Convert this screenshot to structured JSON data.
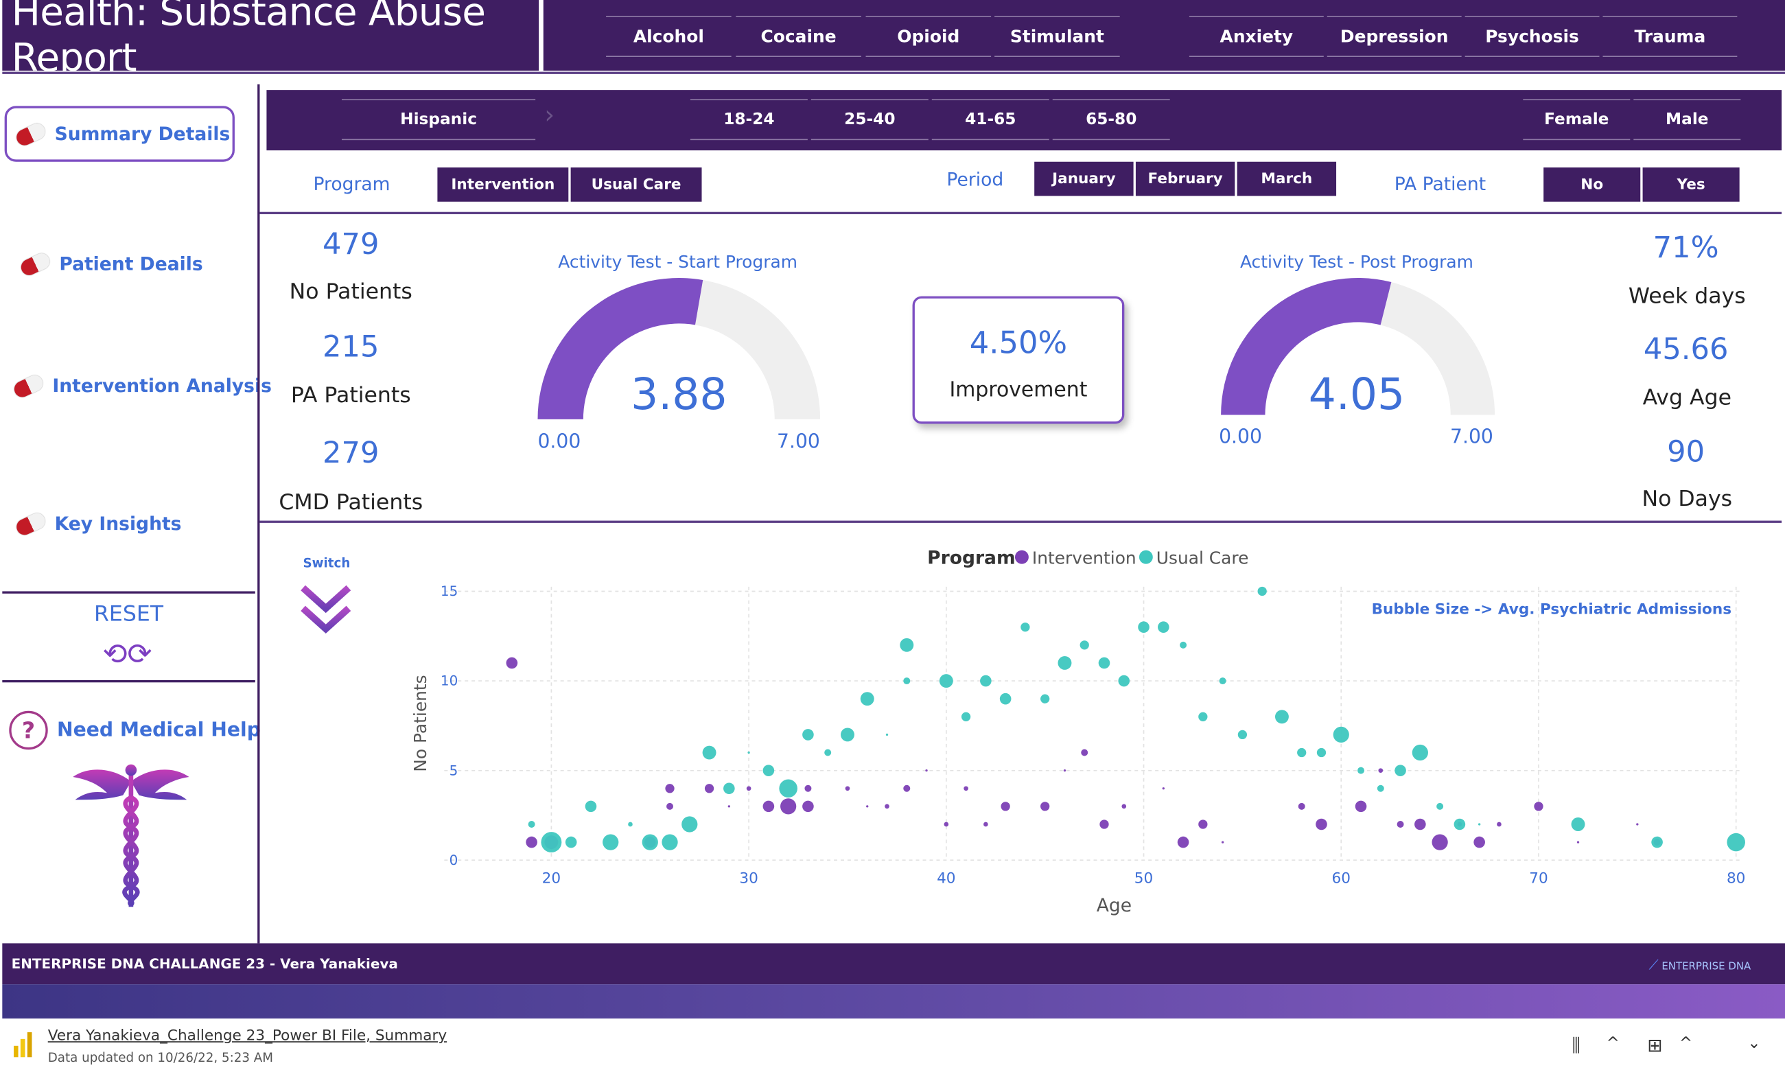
{
  "title": "Health: Substance Abuse Report",
  "substances": [
    "Alcohol",
    "Cocaine",
    "Opioid",
    "Stimulant"
  ],
  "conditions": [
    "Anxiety",
    "Depression",
    "Psychosis",
    "Trauma"
  ],
  "sidebar": {
    "items": [
      "Summary Details",
      "Patient Deails",
      "Intervention Analysis",
      "Key Insights"
    ],
    "reset": "RESET",
    "help": "Need Medical Help"
  },
  "filters": {
    "ethnicity": "Hispanic",
    "ages": [
      "18-24",
      "25-40",
      "41-65",
      "65-80"
    ],
    "genders": [
      "Female",
      "Male"
    ],
    "program_label": "Program",
    "program_options": [
      "Intervention",
      "Usual Care"
    ],
    "period_label": "Period",
    "period_options": [
      "January",
      "February",
      "March"
    ],
    "pa_label": "PA Patient",
    "pa_options": [
      "No",
      "Yes"
    ]
  },
  "kpis": {
    "no_patients": "479",
    "no_patients_label": "No Patients",
    "pa_patients": "215",
    "pa_patients_label": "PA Patients",
    "cmd_patients": "279",
    "cmd_patients_label": "CMD Patients",
    "week_days": "71%",
    "week_days_label": "Week days",
    "avg_age": "45.66",
    "avg_age_label": "Avg Age",
    "no_days": "90",
    "no_days_label": "No Days",
    "improvement": "4.50%",
    "improvement_label": "Improvement"
  },
  "gauges": [
    {
      "title": "Activity Test - Start Program",
      "value": 3.88,
      "value_text": "3.88",
      "min": "0.00",
      "max": "7.00"
    },
    {
      "title": "Activity Test - Post Program",
      "value": 4.05,
      "value_text": "4.05",
      "min": "0.00",
      "max": "7.00"
    }
  ],
  "switch_label": "Switch",
  "chart_data": {
    "type": "scatter",
    "legend_title": "Program",
    "legend": [
      "Intervention",
      "Usual Care"
    ],
    "legend_placement": "top",
    "annotation": "Bubble Size -> Avg. Psychiatric Admissions",
    "xlabel": "Age",
    "ylabel": "No Patients",
    "xlim": [
      18,
      80
    ],
    "ylim": [
      0,
      15
    ],
    "xticks": [
      "20",
      "30",
      "40",
      "50",
      "60",
      "70",
      "80"
    ],
    "yticks": [
      "0",
      "5",
      "10",
      "15"
    ],
    "grid": true,
    "colors": {
      "Intervention": "#7c3fb5",
      "Usual Care": "#3ec7bf"
    },
    "series": [
      {
        "name": "Intervention",
        "points": [
          [
            18,
            11,
            5
          ],
          [
            19,
            1,
            5
          ],
          [
            20,
            1,
            6
          ],
          [
            25,
            1,
            5
          ],
          [
            26,
            3,
            3
          ],
          [
            26,
            4,
            4
          ],
          [
            28,
            4,
            4
          ],
          [
            29,
            3,
            1
          ],
          [
            30,
            4,
            2
          ],
          [
            31,
            3,
            5
          ],
          [
            32,
            3,
            7
          ],
          [
            33,
            3,
            5
          ],
          [
            33,
            4,
            3
          ],
          [
            35,
            4,
            2
          ],
          [
            36,
            3,
            1
          ],
          [
            37,
            3,
            2
          ],
          [
            38,
            4,
            3
          ],
          [
            39,
            5,
            1
          ],
          [
            40,
            2,
            2
          ],
          [
            41,
            4,
            2
          ],
          [
            42,
            2,
            2
          ],
          [
            43,
            3,
            4
          ],
          [
            45,
            3,
            4
          ],
          [
            46,
            5,
            1
          ],
          [
            47,
            6,
            3
          ],
          [
            48,
            2,
            4
          ],
          [
            49,
            3,
            2
          ],
          [
            51,
            4,
            1
          ],
          [
            52,
            1,
            5
          ],
          [
            53,
            2,
            4
          ],
          [
            54,
            1,
            1
          ],
          [
            58,
            3,
            3
          ],
          [
            59,
            2,
            5
          ],
          [
            61,
            3,
            5
          ],
          [
            62,
            5,
            2
          ],
          [
            63,
            2,
            3
          ],
          [
            64,
            2,
            5
          ],
          [
            65,
            1,
            7
          ],
          [
            66,
            2,
            2
          ],
          [
            67,
            1,
            5
          ],
          [
            68,
            2,
            2
          ],
          [
            70,
            3,
            4
          ],
          [
            72,
            1,
            1
          ],
          [
            75,
            2,
            1
          ],
          [
            76,
            1,
            3
          ]
        ]
      },
      {
        "name": "Usual Care",
        "points": [
          [
            19,
            2,
            3
          ],
          [
            20,
            1,
            9
          ],
          [
            21,
            1,
            5
          ],
          [
            22,
            3,
            5
          ],
          [
            23,
            1,
            7
          ],
          [
            24,
            2,
            2
          ],
          [
            25,
            1,
            7
          ],
          [
            26,
            1,
            7
          ],
          [
            27,
            2,
            7
          ],
          [
            28,
            6,
            6
          ],
          [
            29,
            4,
            5
          ],
          [
            30,
            6,
            1
          ],
          [
            31,
            5,
            5
          ],
          [
            32,
            4,
            8
          ],
          [
            33,
            7,
            5
          ],
          [
            34,
            6,
            3
          ],
          [
            35,
            7,
            6
          ],
          [
            36,
            9,
            6
          ],
          [
            37,
            7,
            1
          ],
          [
            38,
            12,
            6
          ],
          [
            38,
            10,
            3
          ],
          [
            40,
            10,
            6
          ],
          [
            41,
            8,
            4
          ],
          [
            42,
            10,
            5
          ],
          [
            43,
            9,
            5
          ],
          [
            44,
            13,
            4
          ],
          [
            45,
            9,
            4
          ],
          [
            46,
            11,
            6
          ],
          [
            47,
            12,
            4
          ],
          [
            48,
            11,
            5
          ],
          [
            49,
            10,
            5
          ],
          [
            50,
            13,
            5
          ],
          [
            51,
            13,
            5
          ],
          [
            52,
            12,
            3
          ],
          [
            53,
            8,
            4
          ],
          [
            54,
            10,
            3
          ],
          [
            55,
            7,
            4
          ],
          [
            56,
            15,
            4
          ],
          [
            57,
            8,
            6
          ],
          [
            58,
            6,
            4
          ],
          [
            59,
            6,
            4
          ],
          [
            60,
            7,
            7
          ],
          [
            61,
            5,
            3
          ],
          [
            62,
            4,
            3
          ],
          [
            63,
            5,
            5
          ],
          [
            64,
            6,
            7
          ],
          [
            65,
            3,
            3
          ],
          [
            66,
            2,
            5
          ],
          [
            67,
            2,
            1
          ],
          [
            72,
            2,
            6
          ],
          [
            76,
            1,
            5
          ],
          [
            80,
            1,
            8
          ]
        ]
      }
    ]
  },
  "footer": {
    "text": "ENTERPRISE DNA CHALLANGE 23 - Vera Yanakieva",
    "logo": "ENTERPRISE DNA"
  },
  "statusbar": {
    "file": "Vera Yanakieva_Challenge 23_Power BI File, Summary",
    "updated": "Data updated on 10/26/22, 5:23 AM"
  }
}
